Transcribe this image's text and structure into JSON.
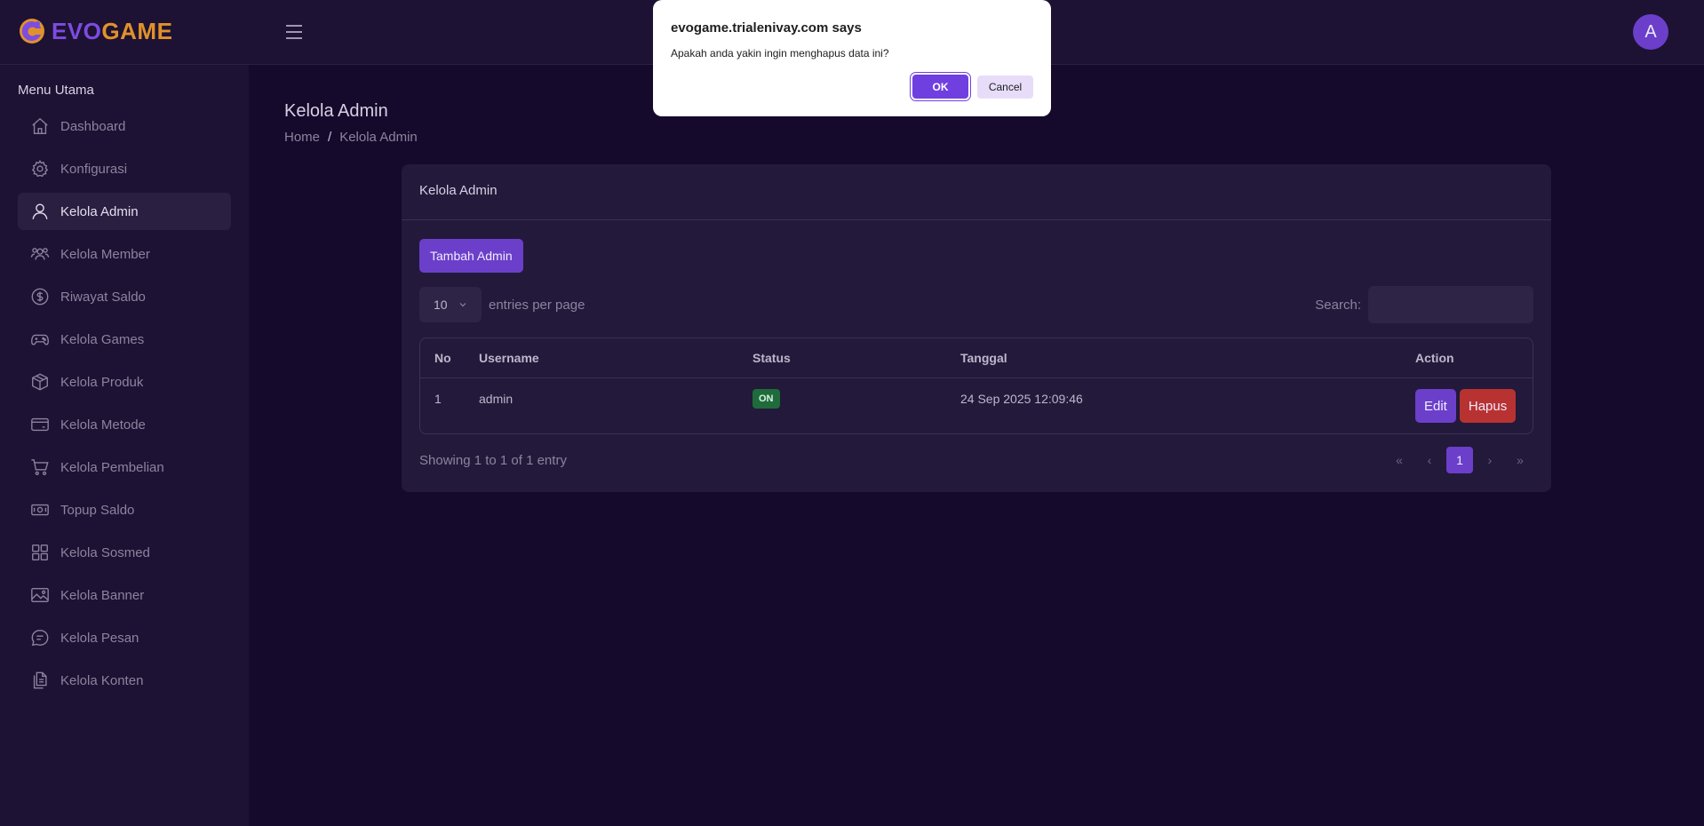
{
  "brand": {
    "logo_text_part1": "EVO",
    "logo_text_part2": "GAME",
    "colors": {
      "evo": "#7d4ce0",
      "game": "#e0922a"
    }
  },
  "user": {
    "avatar_initial": "A"
  },
  "sidebar": {
    "title": "Menu Utama",
    "items": [
      {
        "label": "Dashboard",
        "icon": "home-icon"
      },
      {
        "label": "Konfigurasi",
        "icon": "gear-icon"
      },
      {
        "label": "Kelola Admin",
        "icon": "user-icon",
        "active": true
      },
      {
        "label": "Kelola Member",
        "icon": "users-icon"
      },
      {
        "label": "Riwayat Saldo",
        "icon": "dollar-icon"
      },
      {
        "label": "Kelola Games",
        "icon": "gamepad-icon"
      },
      {
        "label": "Kelola Produk",
        "icon": "box-icon"
      },
      {
        "label": "Kelola Metode",
        "icon": "card-icon"
      },
      {
        "label": "Kelola Pembelian",
        "icon": "cart-icon"
      },
      {
        "label": "Topup Saldo",
        "icon": "cash-icon"
      },
      {
        "label": "Kelola Sosmed",
        "icon": "grid-icon"
      },
      {
        "label": "Kelola Banner",
        "icon": "image-icon"
      },
      {
        "label": "Kelola Pesan",
        "icon": "chat-icon"
      },
      {
        "label": "Kelola Konten",
        "icon": "files-icon"
      }
    ]
  },
  "page": {
    "title": "Kelola Admin",
    "breadcrumb": {
      "home": "Home",
      "sep": "/",
      "current": "Kelola Admin"
    }
  },
  "card": {
    "title": "Kelola Admin",
    "add_button": "Tambah Admin",
    "entries_value": "10",
    "entries_label": "entries per page",
    "search_label": "Search:",
    "search_value": "",
    "table": {
      "headers": {
        "no": "No",
        "username": "Username",
        "status": "Status",
        "tanggal": "Tanggal",
        "action": "Action"
      },
      "rows": [
        {
          "no": "1",
          "username": "admin",
          "status": "ON",
          "tanggal": "24 Sep 2025 12:09:46",
          "edit": "Edit",
          "delete": "Hapus"
        }
      ]
    },
    "showing": "Showing 1 to 1 of 1 entry",
    "pagination": {
      "first": "«",
      "prev": "‹",
      "page": "1",
      "next": "›",
      "last": "»"
    }
  },
  "dialog": {
    "title": "evogame.trialenivay.com says",
    "message": "Apakah anda yakin ingin menghapus data ini?",
    "ok": "OK",
    "cancel": "Cancel"
  }
}
